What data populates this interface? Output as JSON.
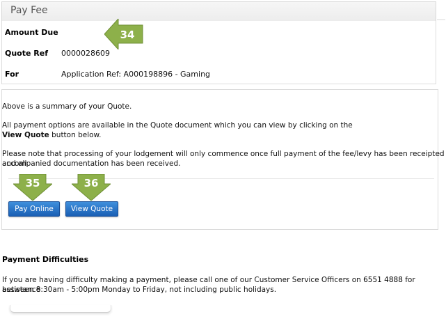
{
  "header": {
    "title": "Pay Fee"
  },
  "summary": {
    "amount_due_label": "Amount Due",
    "quote_ref_label": "Quote Ref",
    "quote_ref_value": "0000028609",
    "for_label": "For",
    "for_value": "Application Ref: A000198896 - Gaming"
  },
  "body": {
    "line1": "Above is a summary of your Quote.",
    "line2": "All payment options are available in the Quote document which you can view by clicking on the",
    "line3_bold": "View Quote",
    "line3_rest": " button below.",
    "line4": "Please note that processing of your lodgement will only commence once full payment of the fee/levy has been receipted and all",
    "line5": "accompanied documentation has been received."
  },
  "buttons": {
    "pay_online": "Pay Online",
    "view_quote": "View Quote"
  },
  "callouts": {
    "c34": "34",
    "c35": "35",
    "c36": "36"
  },
  "difficulties": {
    "heading": "Payment Difficulties",
    "text_part1": "If you are having difficulty making a payment, please call one of our Customer Service Officers on ",
    "phone": "6551 4888",
    "text_part2": " for assistance",
    "text_line2": "between 8:30am - 5:00pm Monday to Friday, not including public holidays."
  },
  "colors": {
    "arrow_green": "#8db04a",
    "button_blue": "#1f66c1"
  }
}
